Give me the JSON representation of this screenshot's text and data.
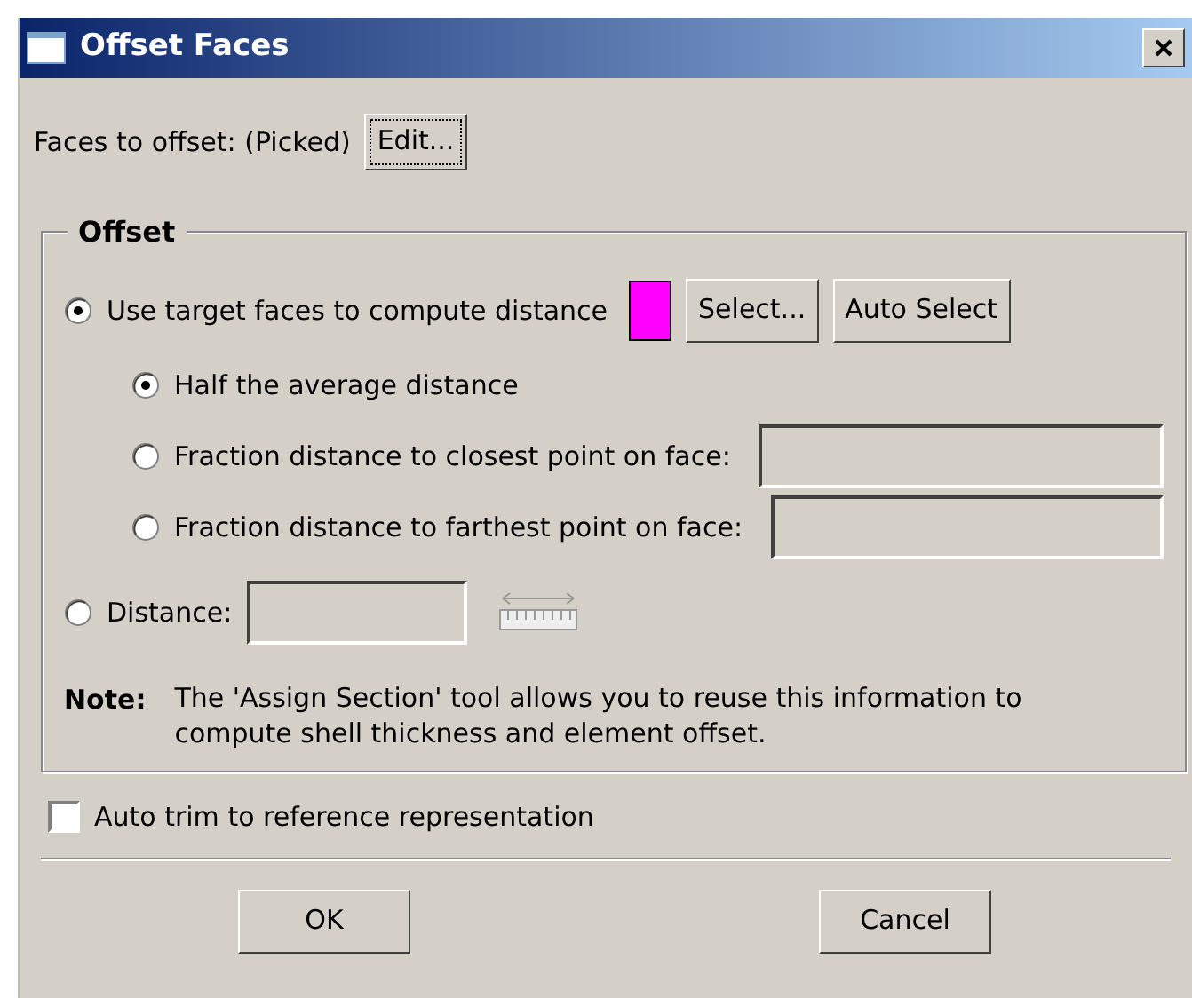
{
  "window": {
    "title": "Offset Faces"
  },
  "faces": {
    "label": "Faces to offset: (Picked)",
    "button": "Edit..."
  },
  "offset": {
    "title": "Offset",
    "options": [
      {
        "label": "Use target faces to compute distance",
        "selected": true,
        "color": "#ff00ff",
        "buttons": [
          "Select...",
          "Auto Select"
        ],
        "sub_options": [
          {
            "label": "Half the average distance",
            "selected": true
          },
          {
            "label": "Fraction distance to closest point on face:",
            "selected": false,
            "field": {
              "disabled": true
            }
          },
          {
            "label": "Fraction distance to farthest point on face:",
            "selected": false,
            "field": {
              "disabled": true
            }
          }
        ]
      },
      {
        "label": "Distance:",
        "selected": false,
        "field": {
          "disabled": true
        },
        "ruler": true
      }
    ],
    "note": {
      "label": "Note:",
      "text": "The 'Assign Section' tool allows you to reuse this information to compute shell thickness and element offset."
    }
  },
  "auto_trim": {
    "label": "Auto trim to reference representation",
    "checked": false
  },
  "buttons": [
    "OK",
    "Cancel"
  ]
}
